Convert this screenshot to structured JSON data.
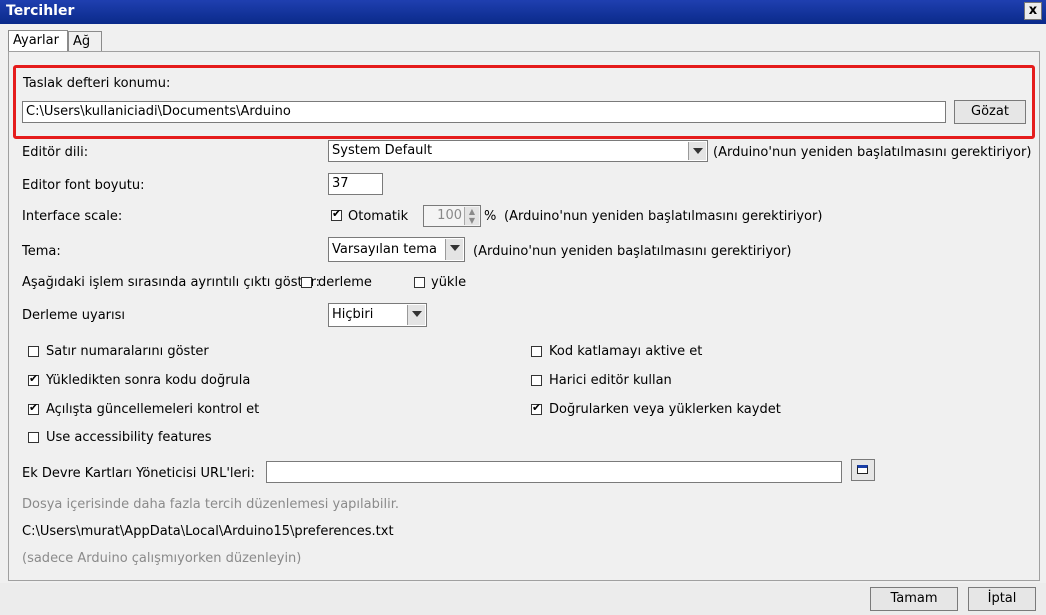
{
  "window": {
    "title": "Tercihler",
    "close": "x"
  },
  "tabs": [
    {
      "label": "Ayarlar"
    },
    {
      "label": "Ağ"
    }
  ],
  "sketchbook": {
    "label": "Taslak defteri konumu:",
    "path": "C:\\Users\\kullaniciadi\\Documents\\Arduino",
    "browse": "Gözat"
  },
  "editor_language": {
    "label": "Editör dili:",
    "value": "System Default",
    "note": "(Arduino'nun yeniden başlatılmasını gerektiriyor)"
  },
  "font_size": {
    "label": "Editor font boyutu:",
    "value": "37"
  },
  "interface_scale": {
    "label": "Interface scale:",
    "auto_label": "Otomatik",
    "auto_checked": true,
    "value": "100",
    "percent": "%",
    "note": "(Arduino'nun yeniden başlatılmasını gerektiriyor)"
  },
  "theme": {
    "label": "Tema:",
    "value": "Varsayılan tema",
    "note": "(Arduino'nun yeniden başlatılmasını gerektiriyor)"
  },
  "verbose": {
    "label": "Aşağıdaki işlem sırasında ayrıntılı çıktı göster:",
    "compile": "derleme",
    "upload": "yükle"
  },
  "warnings": {
    "label": "Derleme uyarısı",
    "value": "Hiçbiri"
  },
  "options": {
    "line_numbers": {
      "label": "Satır numaralarını göster",
      "checked": false
    },
    "verify_after_upload": {
      "label": "Yükledikten sonra kodu doğrula",
      "checked": true
    },
    "check_updates": {
      "label": "Açılışta güncellemeleri kontrol et",
      "checked": true
    },
    "accessibility": {
      "label": "Use accessibility features",
      "checked": false
    },
    "code_folding": {
      "label": "Kod katlamayı aktive et",
      "checked": false
    },
    "external_editor": {
      "label": "Harici editör kullan",
      "checked": false
    },
    "save_on_verify": {
      "label": "Doğrularken veya yüklerken kaydet",
      "checked": true
    }
  },
  "boards_url": {
    "label": "Ek Devre Kartları Yöneticisi URL'leri:",
    "value": ""
  },
  "info": {
    "more_prefs": "Dosya içerisinde daha fazla tercih düzenlemesi yapılabilir.",
    "prefs_path": "C:\\Users\\murat\\AppData\\Local\\Arduino15\\preferences.txt",
    "edit_note": "(sadece Arduino çalışmıyorken düzenleyin)"
  },
  "buttons": {
    "ok": "Tamam",
    "cancel": "İptal"
  }
}
